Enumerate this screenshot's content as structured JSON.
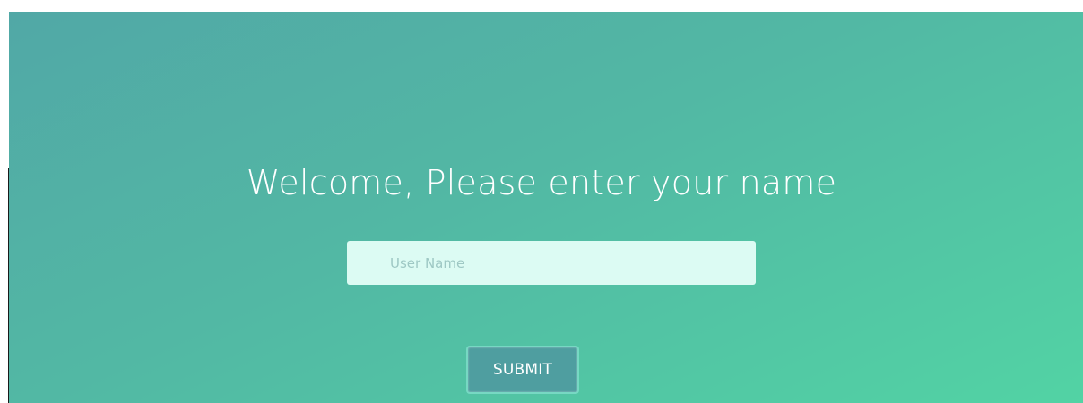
{
  "form": {
    "heading": "Welcome, Please enter your name",
    "username_placeholder": "User Name",
    "username_value": "",
    "submit_label": "SUBMIT"
  },
  "colors": {
    "gradient_start": "#51a8a6",
    "gradient_end": "#52d3a4",
    "input_background": "#dcfbf3",
    "button_background": "#4f9ea0",
    "button_border": "#77d8c3"
  }
}
